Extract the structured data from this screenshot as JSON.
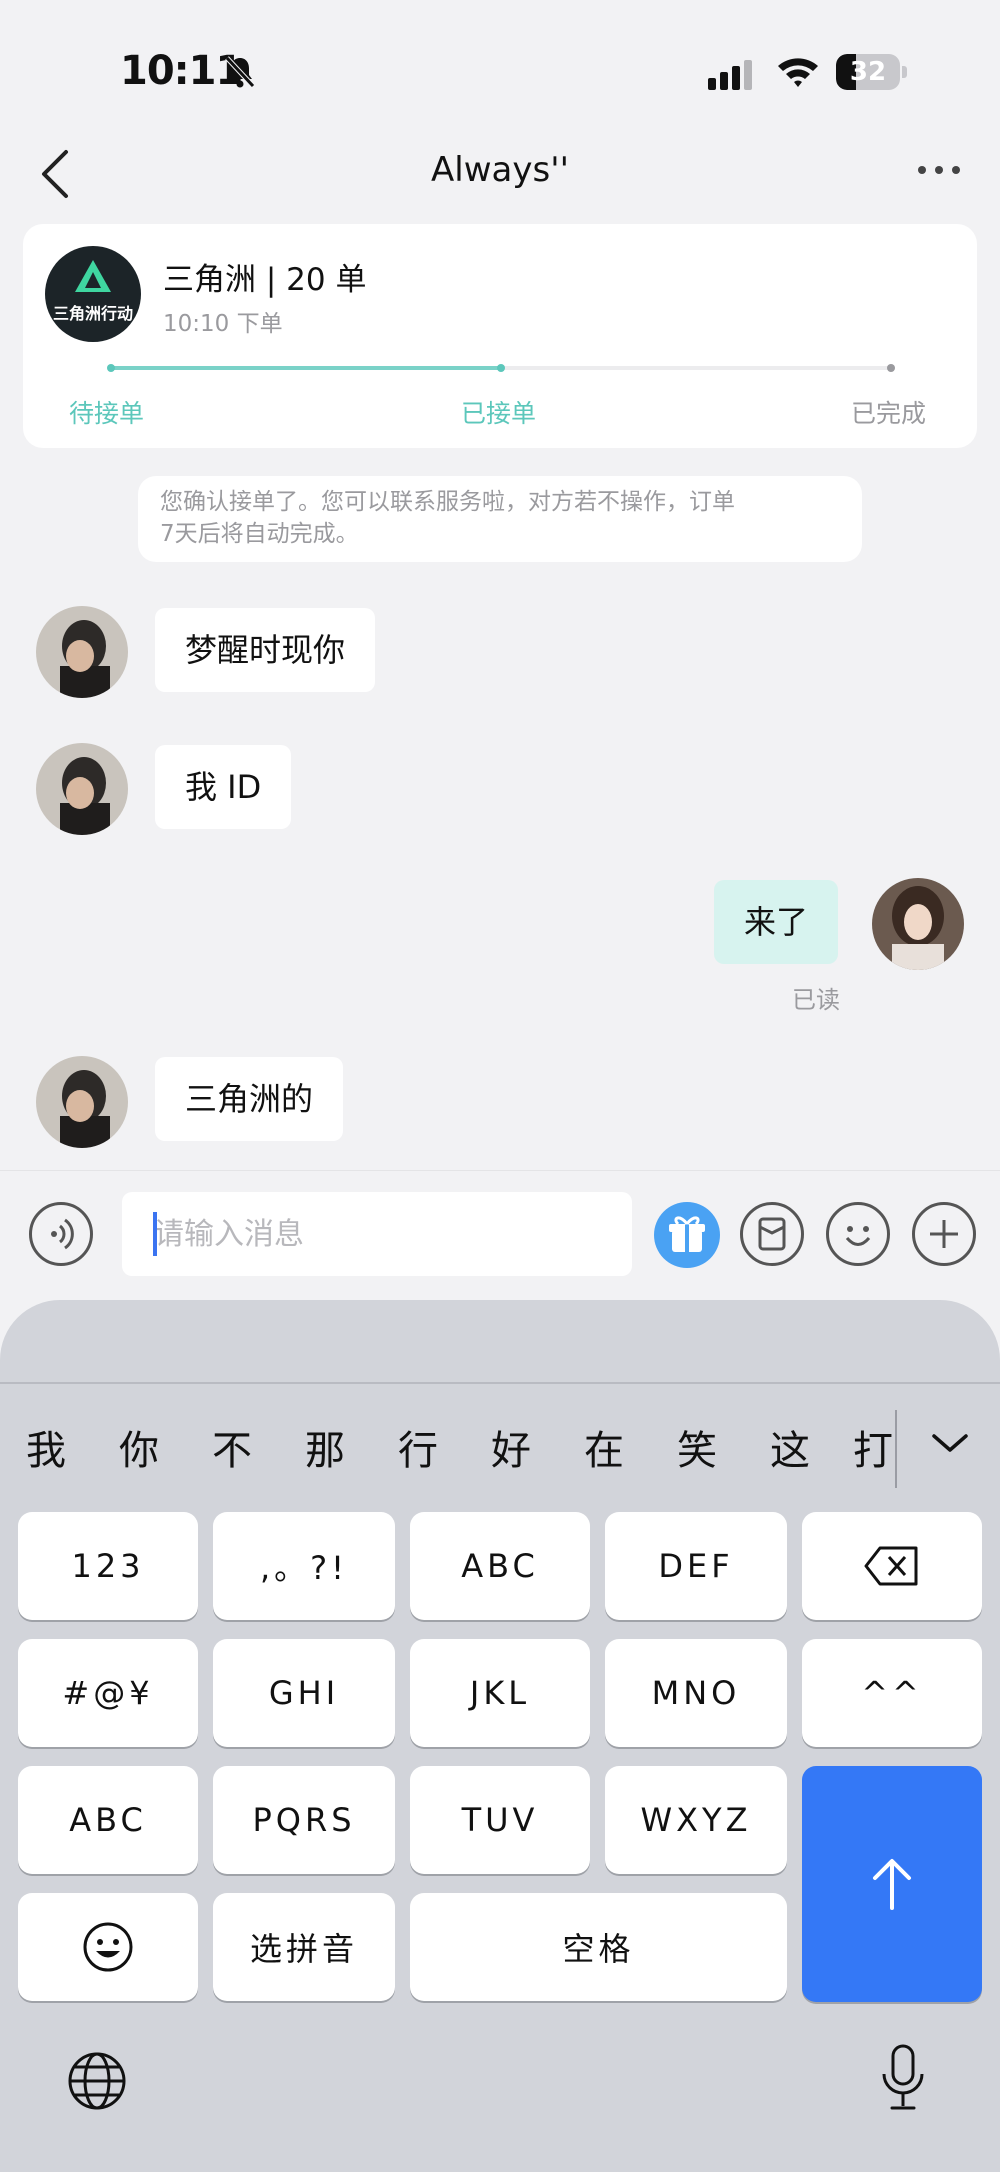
{
  "status_bar": {
    "time": "10:11",
    "battery": "32",
    "battery_level": 0.32
  },
  "nav": {
    "title": "Always''"
  },
  "order": {
    "logo_text": "三角洲行动",
    "title": "三角洲 | 20 单",
    "subtitle": "10:10 下单",
    "steps": [
      "待接单",
      "已接单",
      "已完成"
    ],
    "progress": 0.5,
    "colors": {
      "active": "#5cc7bb",
      "inactive": "#9a9a9e"
    }
  },
  "notice": {
    "line1": "您确认接单了。您可以联系服务啦，对方若不操作，订单",
    "line2": "7天后将自动完成。"
  },
  "messages": [
    {
      "side": "left",
      "text": "梦醒时现你"
    },
    {
      "side": "left",
      "text": "我 ID"
    },
    {
      "side": "right",
      "text": "来了",
      "status": "已读"
    },
    {
      "side": "left",
      "text": "三角洲的"
    }
  ],
  "input": {
    "placeholder": "请输入消息"
  },
  "keyboard": {
    "candidates": [
      "我",
      "你",
      "不",
      "那",
      "行",
      "好",
      "在",
      "笑",
      "这",
      "打"
    ],
    "rows": [
      [
        "123",
        ",。?!",
        "ABC",
        "DEF"
      ],
      [
        "#@¥",
        "GHI",
        "JKL",
        "MNO",
        "^^"
      ],
      [
        "ABC",
        "PQRS",
        "TUV",
        "WXYZ"
      ],
      [
        "选拼音",
        "空格"
      ]
    ]
  }
}
